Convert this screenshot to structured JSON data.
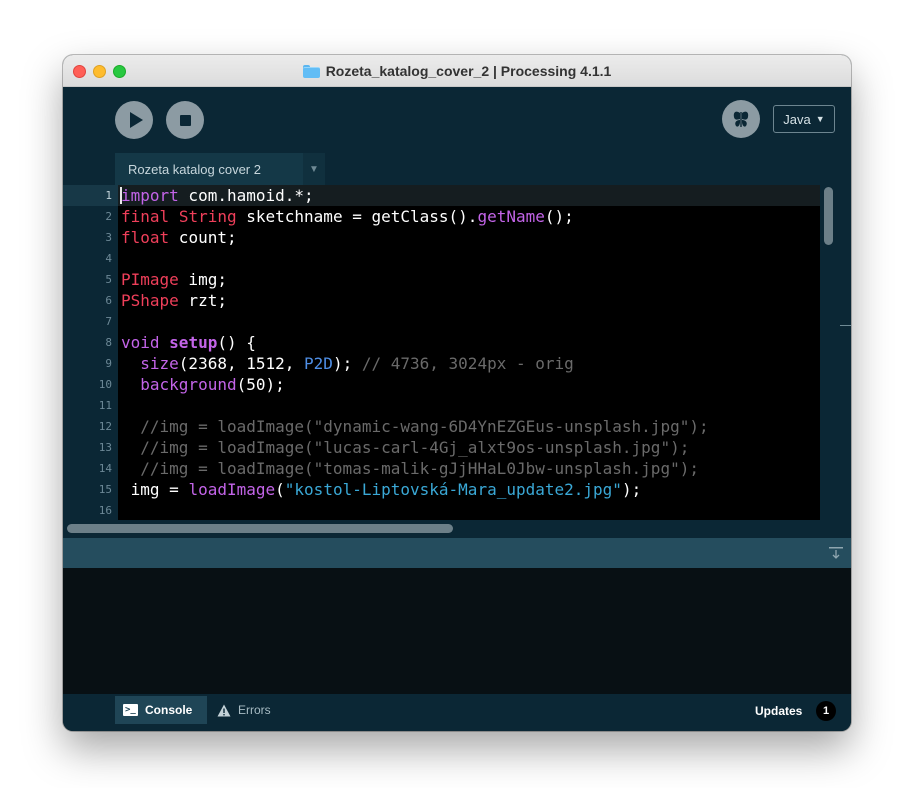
{
  "window": {
    "title": "Rozeta_katalog_cover_2 | Processing 4.1.1"
  },
  "toolbar": {
    "mode_label": "Java",
    "run_icon": "play-icon",
    "stop_icon": "stop-icon",
    "debug_icon": "butterfly-debug-icon"
  },
  "tabs": {
    "sketch_tab_label": "Rozeta katalog cover 2"
  },
  "editor": {
    "line_numbers": [
      "1",
      "2",
      "3",
      "4",
      "5",
      "6",
      "7",
      "8",
      "9",
      "10",
      "11",
      "12",
      "13",
      "14",
      "15",
      "16"
    ],
    "active_line": 1,
    "lines": [
      [
        {
          "t": "import",
          "c": "kw"
        },
        {
          "t": " com.hamoid.*;"
        }
      ],
      [
        {
          "t": "final",
          "c": "ty"
        },
        {
          "t": " "
        },
        {
          "t": "String",
          "c": "ty"
        },
        {
          "t": " sketchname = getClass()."
        },
        {
          "t": "getName",
          "c": "fn"
        },
        {
          "t": "();"
        }
      ],
      [
        {
          "t": "float",
          "c": "ty"
        },
        {
          "t": " count;"
        }
      ],
      [],
      [
        {
          "t": "PImage",
          "c": "ty"
        },
        {
          "t": " img;"
        }
      ],
      [
        {
          "t": "PShape",
          "c": "ty"
        },
        {
          "t": " rzt;"
        }
      ],
      [],
      [
        {
          "t": "void",
          "c": "kw"
        },
        {
          "t": " "
        },
        {
          "t": "setup",
          "c": "fnb"
        },
        {
          "t": "() {"
        }
      ],
      [
        {
          "t": "  "
        },
        {
          "t": "size",
          "c": "fn"
        },
        {
          "t": "(2368, 1512, "
        },
        {
          "t": "P2D",
          "c": "cst"
        },
        {
          "t": "); "
        },
        {
          "t": "// 4736, 3024px - orig",
          "c": "cm"
        }
      ],
      [
        {
          "t": "  "
        },
        {
          "t": "background",
          "c": "fn"
        },
        {
          "t": "(50);"
        }
      ],
      [],
      [
        {
          "t": "  //img = loadImage(\"dynamic-wang-6D4YnEZGEus-unsplash.jpg\");",
          "c": "cm"
        }
      ],
      [
        {
          "t": "  //img = loadImage(\"lucas-carl-4Gj_alxt9os-unsplash.jpg\");",
          "c": "cm"
        }
      ],
      [
        {
          "t": "  //img = loadImage(\"tomas-malik-gJjHHaL0Jbw-unsplash.jpg\");",
          "c": "cm"
        }
      ],
      [
        {
          "t": " img = "
        },
        {
          "t": "loadImage",
          "c": "fn"
        },
        {
          "t": "("
        },
        {
          "t": "\"kostol-Liptovská-Mara_update2.jpg\"",
          "c": "str"
        },
        {
          "t": ");"
        }
      ],
      []
    ]
  },
  "footer": {
    "console_label": "Console",
    "errors_label": "Errors",
    "updates_label": "Updates",
    "updates_count": "1"
  },
  "colors": {
    "toolbar_bg": "#0b2735",
    "editor_bg": "#000000",
    "keyword": "#c364e8",
    "type": "#ef3f5a",
    "constant": "#4f8fe6",
    "comment": "#6a6a6a",
    "string": "#3aa8d6"
  }
}
